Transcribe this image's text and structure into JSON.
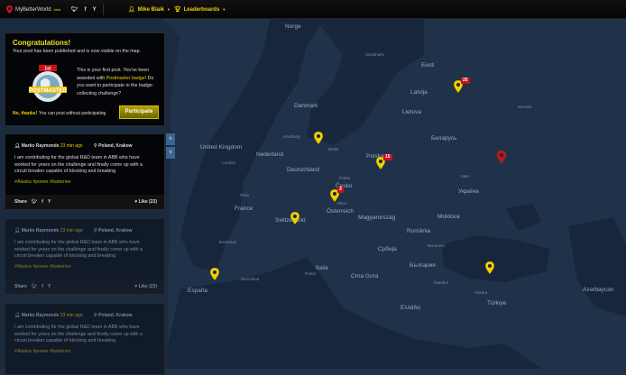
{
  "topbar": {
    "brand": "MyBetterWorld",
    "beta": "beta",
    "social": [
      "twitter-icon",
      "facebook-icon",
      "yammer-icon"
    ],
    "user": "Mike Blaik",
    "leaderboards": "Leaderboards"
  },
  "congrats": {
    "title": "Congratulations!",
    "subtitle": "Your post has been published and is now visible on the map.",
    "text1": "This is your first post. You've been awarded with ",
    "badge_name": "Postmaster badge!",
    "text2": "Do you want to participate in the badge-collecting challenge?",
    "badge_label": "POSTMASTER",
    "badge_ribbon": "1st",
    "no_thanks": "No, thanks!",
    "no_thanks_hint": "You can post without participating",
    "participate": "Participate"
  },
  "posts": [
    {
      "author": "Marko Raymonds",
      "time": "23 min ago",
      "location": "Poland, Krakow",
      "body": "I am contributing for the global R&D team in ABB who have worked for years on the challenge and finally come up with a circuit breaker capable of blocking and breaking",
      "tags": "#Alaska  #power  #batteries",
      "share": "Share",
      "like": "Like (23)"
    },
    {
      "author": "Marko Raymonds",
      "time": "23 min ago",
      "location": "Poland, Krakow",
      "body": "I am contributing for the global R&D team in ABB who have worked for years on the challenge and finally come up with a circuit breaker capable of blocking and breaking",
      "tags": "#Alaska  #power  #batteries",
      "share": "Share",
      "like": "Like (23)"
    },
    {
      "author": "Marko Raymonds",
      "time": "23 min ago",
      "location": "Poland, Krakow",
      "body": "I am contributing for the global R&D team in ABB who have worked for years on the challenge and finally come up with a circuit breaker capable of blocking and breaking",
      "tags": "#Alaska  #power  #batteries"
    }
  ],
  "map": {
    "countries": [
      "Norge",
      "Danmark",
      "United Kingdom",
      "Nederland",
      "Deutschland",
      "Polska",
      "Latvija",
      "Lietuva",
      "Eesti",
      "Беларусь",
      "Україна",
      "France",
      "Česko",
      "Österreich",
      "Magyarország",
      "Moldova",
      "România",
      "Italia",
      "España",
      "България",
      "Србија",
      "Crna Gora",
      "Ελλάδα",
      "Türkiye",
      "Azərbaycan",
      "Switzerland"
    ],
    "cities": [
      "Stockholm",
      "Berlin",
      "London",
      "Paris",
      "Москва",
      "Київ",
      "Wien",
      "Roma",
      "İstanbul",
      "Ankara",
      "Barcelona",
      "Bordeaux",
      "Hamburg",
      "Praha",
      "Bucuresti"
    ],
    "badges": [
      "25",
      "15",
      "3"
    ],
    "colors": {
      "marker": "#f0d000",
      "alert": "#c8101e",
      "accent": "#3b6590"
    }
  }
}
